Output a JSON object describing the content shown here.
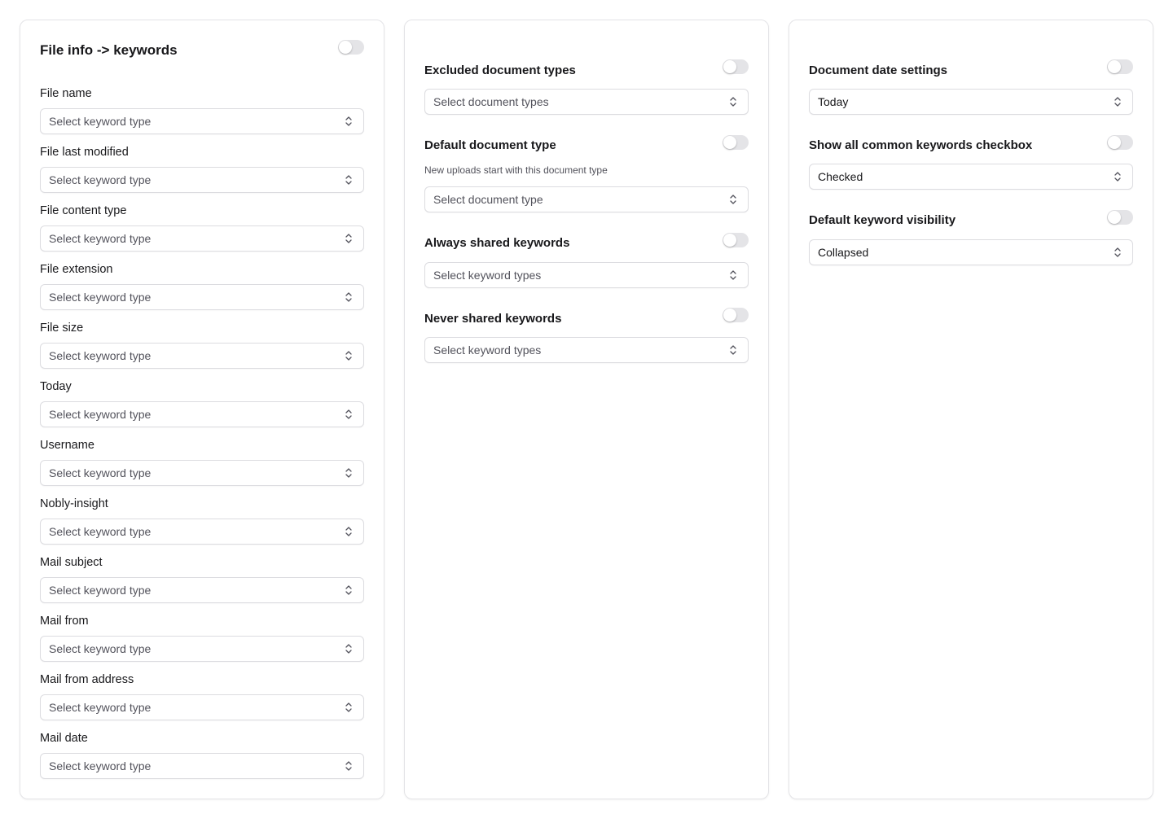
{
  "col1": {
    "title": "File info -> keywords",
    "fields": [
      {
        "label": "File name",
        "value": "Select keyword type"
      },
      {
        "label": "File last modified",
        "value": "Select keyword type"
      },
      {
        "label": "File content type",
        "value": "Select keyword type"
      },
      {
        "label": "File extension",
        "value": "Select keyword type"
      },
      {
        "label": "File size",
        "value": "Select keyword type"
      },
      {
        "label": "Today",
        "value": "Select keyword type"
      },
      {
        "label": "Username",
        "value": "Select keyword type"
      },
      {
        "label": "Nobly-insight",
        "value": "Select keyword type"
      },
      {
        "label": "Mail subject",
        "value": "Select keyword type"
      },
      {
        "label": "Mail from",
        "value": "Select keyword type"
      },
      {
        "label": "Mail from address",
        "value": "Select keyword type"
      },
      {
        "label": "Mail date",
        "value": "Select keyword type"
      }
    ]
  },
  "col2": {
    "sections": [
      {
        "title": "Excluded document types",
        "value": "Select document types"
      },
      {
        "title": "Default document type",
        "description": "New uploads start with this document type",
        "value": "Select document type"
      },
      {
        "title": "Always shared keywords",
        "value": "Select keyword types"
      },
      {
        "title": "Never shared keywords",
        "value": "Select keyword types"
      }
    ]
  },
  "col3": {
    "sections": [
      {
        "title": "Document date settings",
        "value": "Today"
      },
      {
        "title": "Show all common keywords checkbox",
        "value": "Checked"
      },
      {
        "title": "Default keyword visibility",
        "value": "Collapsed"
      }
    ]
  },
  "colors": {
    "border": "#e4e4e7",
    "toggle_off": "#e4e4e7",
    "placeholder": "#52525b",
    "text": "#18181b"
  },
  "icons": {
    "select_chevron": "chevron-up-down-icon"
  }
}
